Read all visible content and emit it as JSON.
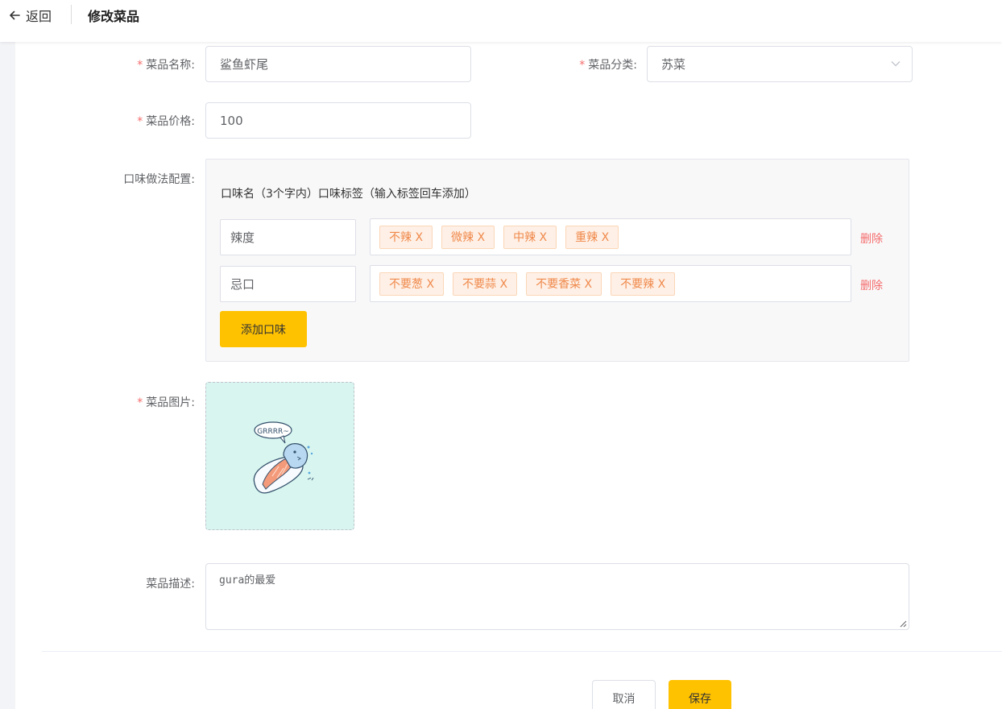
{
  "header": {
    "back_label": "返回",
    "title": "修改菜品"
  },
  "form": {
    "name": {
      "label": "菜品名称:",
      "value": "鲨鱼虾尾",
      "required_mark": "*"
    },
    "category": {
      "label": "菜品分类:",
      "value": "苏菜",
      "required_mark": "*"
    },
    "price": {
      "label": "菜品价格:",
      "value": "100",
      "required_mark": "*"
    },
    "flavor": {
      "label": "口味做法配置:",
      "header": "口味名（3个字内）口味标签（输入标签回车添加）",
      "rows": [
        {
          "name": "辣度",
          "tags": [
            "不辣 X",
            "微辣 X",
            "中辣 X",
            "重辣 X"
          ],
          "delete_label": "删除"
        },
        {
          "name": "忌口",
          "tags": [
            "不要葱 X",
            "不要蒜 X",
            "不要香菜 X",
            "不要辣 X"
          ],
          "delete_label": "删除"
        }
      ],
      "add_label": "添加口味"
    },
    "image": {
      "label": "菜品图片:",
      "required_mark": "*",
      "bubble_text": "GRRRR~"
    },
    "description": {
      "label": "菜品描述:",
      "value": "gura的最爱"
    }
  },
  "actions": {
    "cancel_label": "取消",
    "save_label": "保存"
  },
  "colors": {
    "accent": "#ffc200",
    "danger": "#f56c6c",
    "tag_text": "#f0894b",
    "tag_bg": "#fef0e6",
    "upload_bg": "#d8f5f0"
  }
}
